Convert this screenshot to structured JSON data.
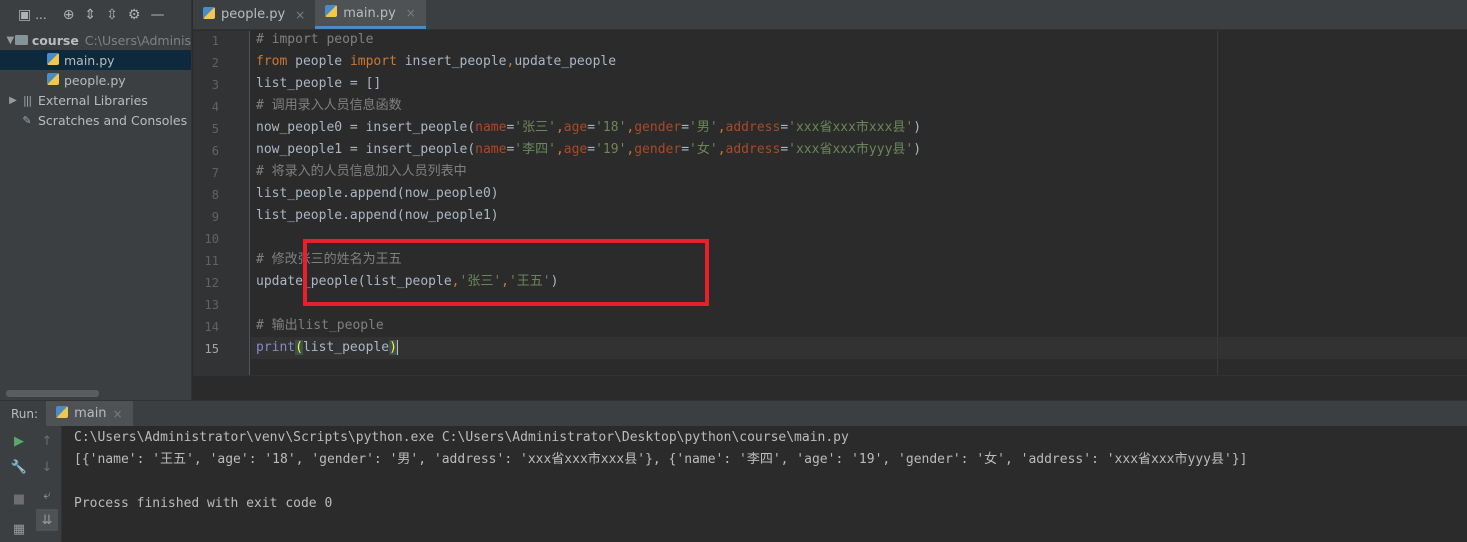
{
  "project": {
    "root_name": "course",
    "root_path": "C:\\Users\\Adminis",
    "title": "...",
    "files": [
      "main.py",
      "people.py"
    ],
    "external_libraries": "External Libraries",
    "scratches": "Scratches and Consoles"
  },
  "tabs": [
    {
      "label": "people.py"
    },
    {
      "label": "main.py"
    }
  ],
  "editor": {
    "line_numbers": [
      "1",
      "2",
      "3",
      "4",
      "5",
      "6",
      "7",
      "8",
      "9",
      "10",
      "11",
      "12",
      "13",
      "14",
      "15"
    ],
    "current_line": "15"
  },
  "run": {
    "label": "Run:",
    "tab_label": "main",
    "console": [
      "C:\\Users\\Administrator\\venv\\Scripts\\python.exe C:\\Users\\Administrator\\Desktop\\python\\course\\main.py",
      "[{'name': '王五', 'age': '18', 'gender': '男', 'address': 'xxx省xxx市xxx县'}, {'name': '李四', 'age': '19', 'gender': '女', 'address': 'xxx省xxx市yyy县'}]",
      "",
      "Process finished with exit code 0"
    ]
  },
  "colors": {
    "accent": "#4a88c7",
    "highlight_box": "#e8202a",
    "keyword": "#cc7832",
    "string": "#6a8759",
    "param": "#aa4926",
    "comment": "#808080"
  }
}
